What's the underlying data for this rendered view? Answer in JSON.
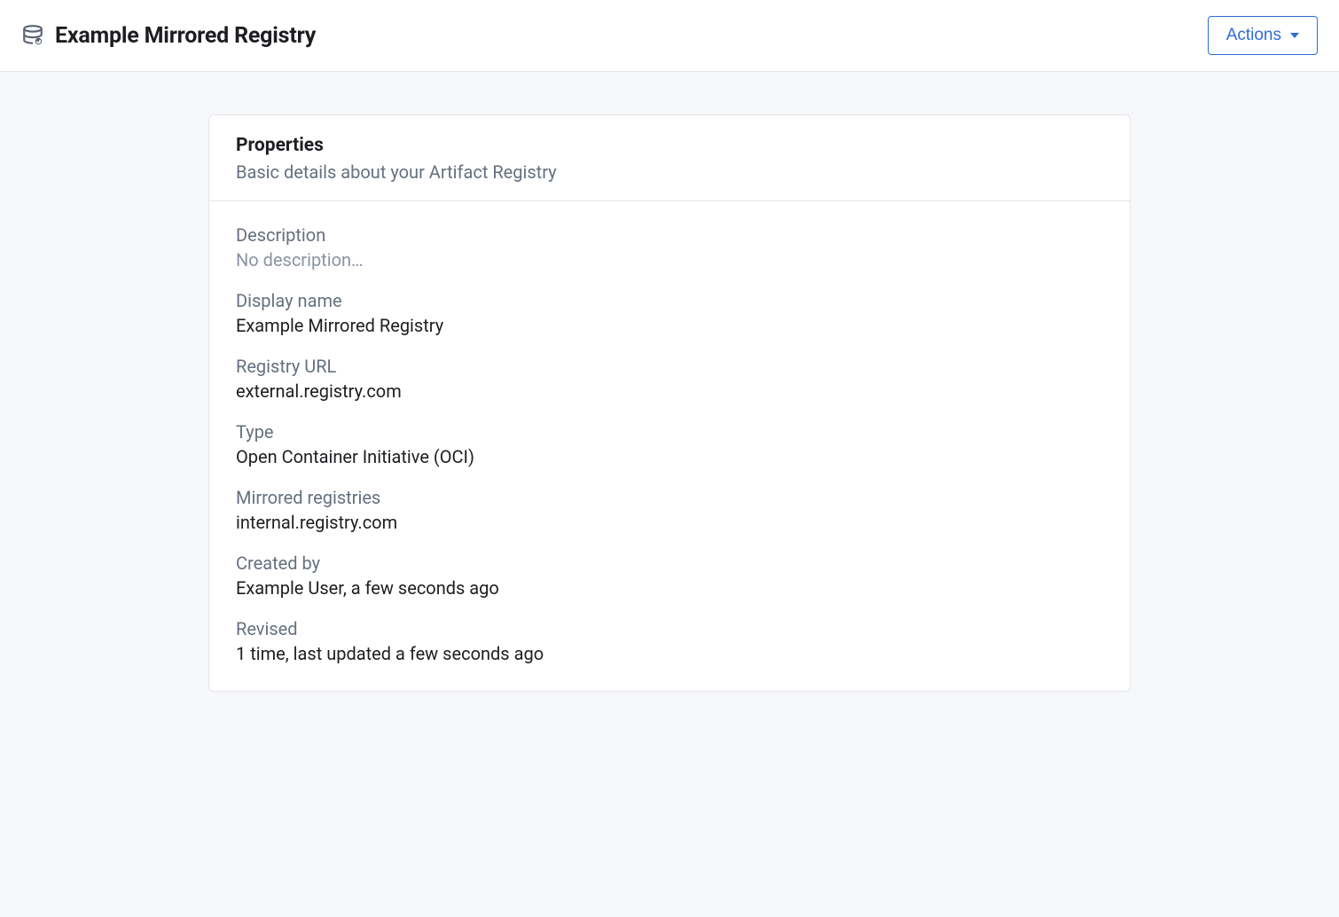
{
  "header": {
    "title": "Example Mirrored Registry",
    "actions_label": "Actions"
  },
  "card": {
    "title": "Properties",
    "subtitle": "Basic details about your Artifact Registry"
  },
  "properties": {
    "description": {
      "label": "Description",
      "value": "No description…"
    },
    "display_name": {
      "label": "Display name",
      "value": "Example Mirrored Registry"
    },
    "registry_url": {
      "label": "Registry URL",
      "value": "external.registry.com"
    },
    "type": {
      "label": "Type",
      "value": "Open Container Initiative (OCI)"
    },
    "mirrored_registries": {
      "label": "Mirrored registries",
      "value": "internal.registry.com"
    },
    "created_by": {
      "label": "Created by",
      "value": "Example User, a few seconds ago"
    },
    "revised": {
      "label": "Revised",
      "value": "1 time, last updated a few seconds ago"
    }
  }
}
